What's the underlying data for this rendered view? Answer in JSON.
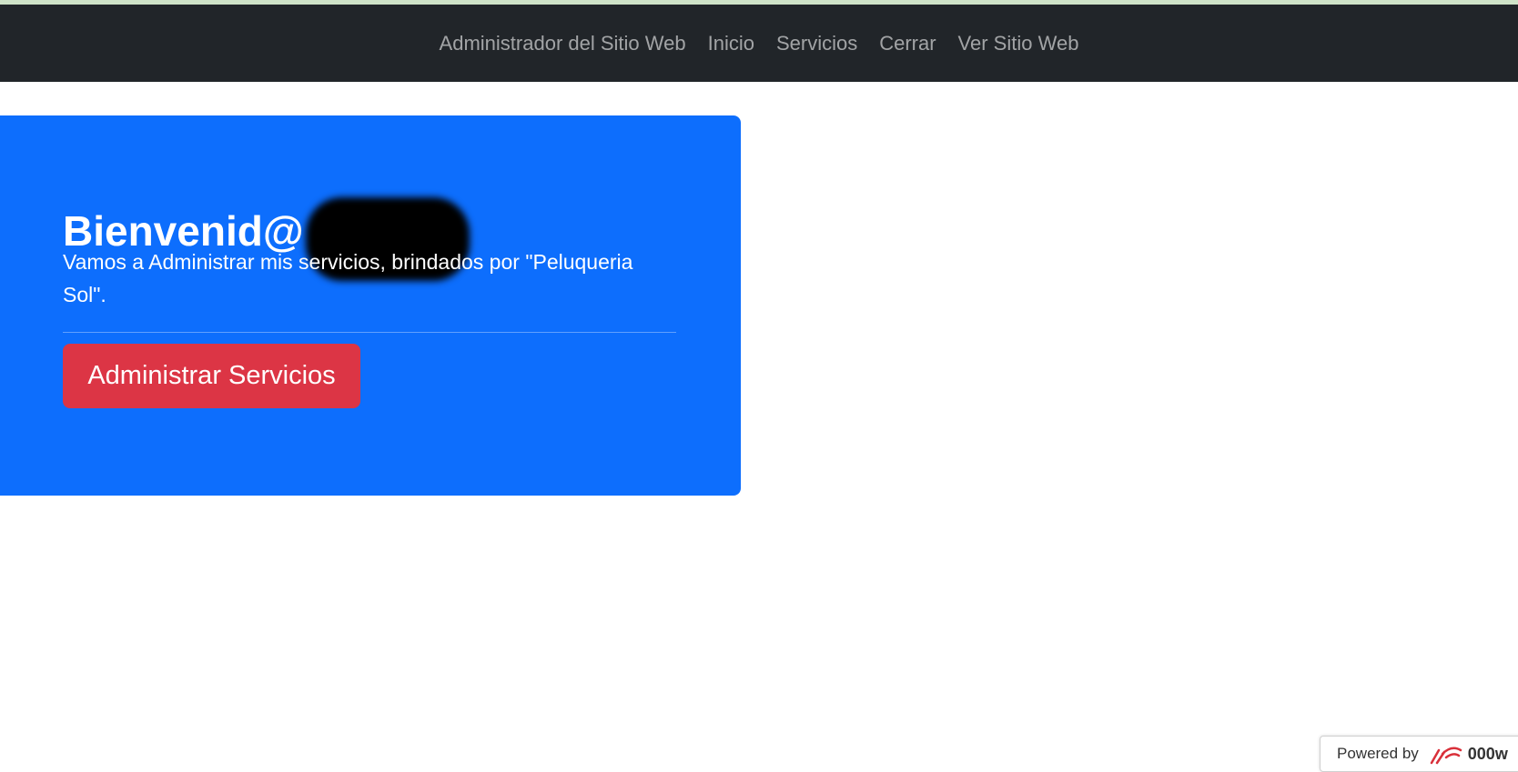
{
  "navbar": {
    "brand": "Administrador del Sitio Web",
    "items": [
      {
        "label": "Inicio"
      },
      {
        "label": "Servicios"
      },
      {
        "label": "Cerrar"
      },
      {
        "label": "Ver Sitio Web"
      }
    ]
  },
  "jumbotron": {
    "title": "Bienvenid@",
    "lead": "Vamos a Administrar mis servicios, brindados por \"Peluqueria Sol\".",
    "button_label": "Administrar Servicios"
  },
  "footer_badge": {
    "powered_text": "Powered by",
    "brand_text": "000w"
  },
  "colors": {
    "navbar_bg": "#212529",
    "jumbotron_bg": "#0d6efd",
    "button_bg": "#dc3545"
  }
}
